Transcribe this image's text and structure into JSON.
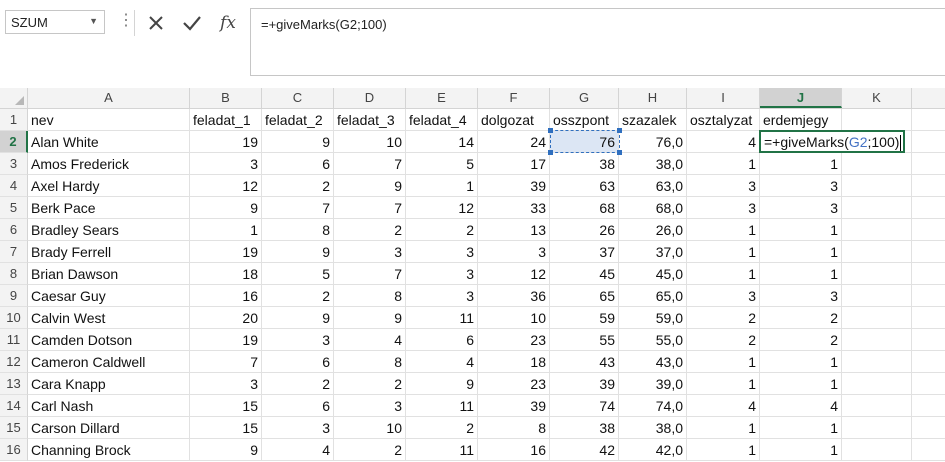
{
  "formula_bar": {
    "name_box": "SZUM",
    "formula": "=+giveMarks(G2;100)"
  },
  "icons": {
    "cancel": "x-icon",
    "enter": "checkmark-icon",
    "insert_function": "fx-icon",
    "fx_label": "fx",
    "more": "more-vertical-icon"
  },
  "columns": [
    "A",
    "B",
    "C",
    "D",
    "E",
    "F",
    "G",
    "H",
    "I",
    "J",
    "K"
  ],
  "selected_column": "J",
  "rows": [
    {
      "n": "1",
      "cells": [
        "nev",
        "feladat_1",
        "feladat_2",
        "feladat_3",
        "feladat_4",
        "dolgozat",
        "osszpont",
        "szazalek",
        "osztalyzat",
        "erdemjegy",
        ""
      ]
    },
    {
      "n": "2",
      "cells": [
        "Alan White",
        "19",
        "9",
        "10",
        "14",
        "24",
        "76",
        "76,0",
        "4",
        "",
        ""
      ]
    },
    {
      "n": "3",
      "cells": [
        "Amos Frederick",
        "3",
        "6",
        "7",
        "5",
        "17",
        "38",
        "38,0",
        "1",
        "1",
        ""
      ]
    },
    {
      "n": "4",
      "cells": [
        "Axel Hardy",
        "12",
        "2",
        "9",
        "1",
        "39",
        "63",
        "63,0",
        "3",
        "3",
        ""
      ]
    },
    {
      "n": "5",
      "cells": [
        "Berk Pace",
        "9",
        "7",
        "7",
        "12",
        "33",
        "68",
        "68,0",
        "3",
        "3",
        ""
      ]
    },
    {
      "n": "6",
      "cells": [
        "Bradley Sears",
        "1",
        "8",
        "2",
        "2",
        "13",
        "26",
        "26,0",
        "1",
        "1",
        ""
      ]
    },
    {
      "n": "7",
      "cells": [
        "Brady Ferrell",
        "19",
        "9",
        "3",
        "3",
        "3",
        "37",
        "37,0",
        "1",
        "1",
        ""
      ]
    },
    {
      "n": "8",
      "cells": [
        "Brian Dawson",
        "18",
        "5",
        "7",
        "3",
        "12",
        "45",
        "45,0",
        "1",
        "1",
        ""
      ]
    },
    {
      "n": "9",
      "cells": [
        "Caesar Guy",
        "16",
        "2",
        "8",
        "3",
        "36",
        "65",
        "65,0",
        "3",
        "3",
        ""
      ]
    },
    {
      "n": "10",
      "cells": [
        "Calvin West",
        "20",
        "9",
        "9",
        "11",
        "10",
        "59",
        "59,0",
        "2",
        "2",
        ""
      ]
    },
    {
      "n": "11",
      "cells": [
        "Camden Dotson",
        "19",
        "3",
        "4",
        "6",
        "23",
        "55",
        "55,0",
        "2",
        "2",
        ""
      ]
    },
    {
      "n": "12",
      "cells": [
        "Cameron Caldwell",
        "7",
        "6",
        "8",
        "4",
        "18",
        "43",
        "43,0",
        "1",
        "1",
        ""
      ]
    },
    {
      "n": "13",
      "cells": [
        "Cara Knapp",
        "3",
        "2",
        "2",
        "9",
        "23",
        "39",
        "39,0",
        "1",
        "1",
        ""
      ]
    },
    {
      "n": "14",
      "cells": [
        "Carl Nash",
        "15",
        "6",
        "3",
        "11",
        "39",
        "74",
        "74,0",
        "4",
        "4",
        ""
      ]
    },
    {
      "n": "15",
      "cells": [
        "Carson Dillard",
        "15",
        "3",
        "10",
        "2",
        "8",
        "38",
        "38,0",
        "1",
        "1",
        ""
      ]
    },
    {
      "n": "16",
      "cells": [
        "Channing Brock",
        "9",
        "4",
        "2",
        "11",
        "16",
        "42",
        "42,0",
        "1",
        "1",
        ""
      ]
    }
  ],
  "active_cell": {
    "address": "J2",
    "prefix": "=+giveMarks(",
    "ref": "G2",
    "suffix": ";100)"
  }
}
